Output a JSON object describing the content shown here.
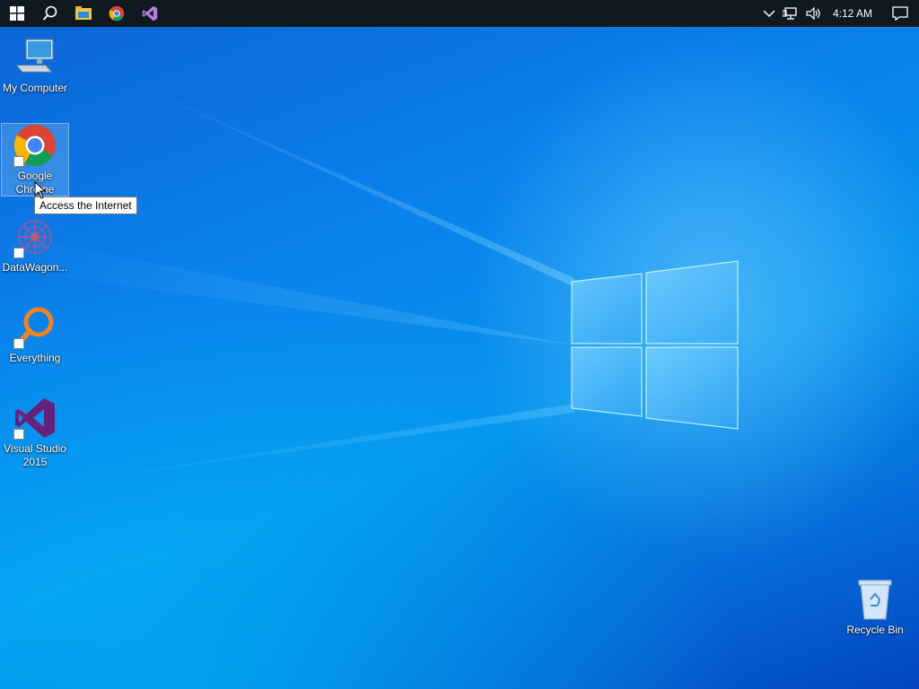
{
  "taskbar": {
    "pinned": [
      {
        "name": "start-icon"
      },
      {
        "name": "search-icon"
      },
      {
        "name": "file-explorer-icon"
      },
      {
        "name": "chrome-icon"
      },
      {
        "name": "visual-studio-icon"
      }
    ],
    "tray": {
      "clock": "4:12 AM",
      "icons": [
        "chevron-up-icon",
        "network-icon",
        "volume-icon",
        "notification-icon"
      ]
    },
    "background": "#101820"
  },
  "desktop": {
    "icons": [
      {
        "label": "My Computer",
        "icon": "computer-icon"
      },
      {
        "label": "Google Chrome",
        "icon": "chrome-icon",
        "selected": true
      },
      {
        "label": "DataWagon...",
        "icon": "datawagon-icon"
      },
      {
        "label": "Everything",
        "icon": "everything-search-icon"
      },
      {
        "label": "Visual Studio 2015",
        "icon": "visual-studio-icon"
      },
      {
        "label": "Recycle Bin",
        "icon": "recycle-bin-icon"
      }
    ],
    "tooltip": "Access the Internet"
  },
  "colors": {
    "wallpaper_primary": "#0a82ec",
    "taskbar": "#101820",
    "vs_purple": "#68217a",
    "everything_orange": "#f58220"
  }
}
